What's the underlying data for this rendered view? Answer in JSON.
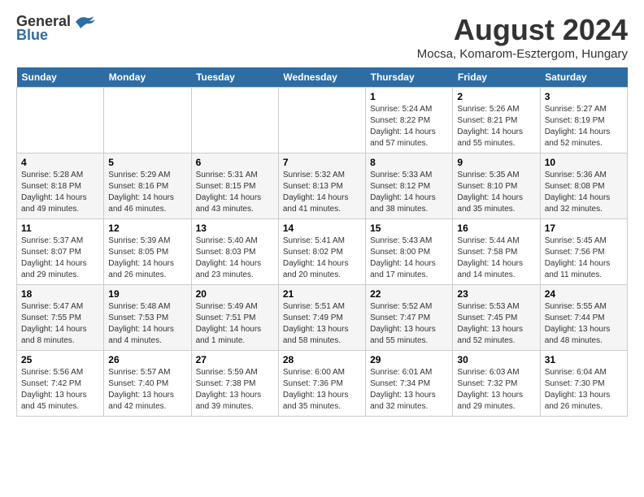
{
  "header": {
    "logo_general": "General",
    "logo_blue": "Blue",
    "month_year": "August 2024",
    "location": "Mocsa, Komarom-Esztergom, Hungary"
  },
  "days_of_week": [
    "Sunday",
    "Monday",
    "Tuesday",
    "Wednesday",
    "Thursday",
    "Friday",
    "Saturday"
  ],
  "weeks": [
    [
      {
        "day": "",
        "info": ""
      },
      {
        "day": "",
        "info": ""
      },
      {
        "day": "",
        "info": ""
      },
      {
        "day": "",
        "info": ""
      },
      {
        "day": "1",
        "info": "Sunrise: 5:24 AM\nSunset: 8:22 PM\nDaylight: 14 hours and 57 minutes."
      },
      {
        "day": "2",
        "info": "Sunrise: 5:26 AM\nSunset: 8:21 PM\nDaylight: 14 hours and 55 minutes."
      },
      {
        "day": "3",
        "info": "Sunrise: 5:27 AM\nSunset: 8:19 PM\nDaylight: 14 hours and 52 minutes."
      }
    ],
    [
      {
        "day": "4",
        "info": "Sunrise: 5:28 AM\nSunset: 8:18 PM\nDaylight: 14 hours and 49 minutes."
      },
      {
        "day": "5",
        "info": "Sunrise: 5:29 AM\nSunset: 8:16 PM\nDaylight: 14 hours and 46 minutes."
      },
      {
        "day": "6",
        "info": "Sunrise: 5:31 AM\nSunset: 8:15 PM\nDaylight: 14 hours and 43 minutes."
      },
      {
        "day": "7",
        "info": "Sunrise: 5:32 AM\nSunset: 8:13 PM\nDaylight: 14 hours and 41 minutes."
      },
      {
        "day": "8",
        "info": "Sunrise: 5:33 AM\nSunset: 8:12 PM\nDaylight: 14 hours and 38 minutes."
      },
      {
        "day": "9",
        "info": "Sunrise: 5:35 AM\nSunset: 8:10 PM\nDaylight: 14 hours and 35 minutes."
      },
      {
        "day": "10",
        "info": "Sunrise: 5:36 AM\nSunset: 8:08 PM\nDaylight: 14 hours and 32 minutes."
      }
    ],
    [
      {
        "day": "11",
        "info": "Sunrise: 5:37 AM\nSunset: 8:07 PM\nDaylight: 14 hours and 29 minutes."
      },
      {
        "day": "12",
        "info": "Sunrise: 5:39 AM\nSunset: 8:05 PM\nDaylight: 14 hours and 26 minutes."
      },
      {
        "day": "13",
        "info": "Sunrise: 5:40 AM\nSunset: 8:03 PM\nDaylight: 14 hours and 23 minutes."
      },
      {
        "day": "14",
        "info": "Sunrise: 5:41 AM\nSunset: 8:02 PM\nDaylight: 14 hours and 20 minutes."
      },
      {
        "day": "15",
        "info": "Sunrise: 5:43 AM\nSunset: 8:00 PM\nDaylight: 14 hours and 17 minutes."
      },
      {
        "day": "16",
        "info": "Sunrise: 5:44 AM\nSunset: 7:58 PM\nDaylight: 14 hours and 14 minutes."
      },
      {
        "day": "17",
        "info": "Sunrise: 5:45 AM\nSunset: 7:56 PM\nDaylight: 14 hours and 11 minutes."
      }
    ],
    [
      {
        "day": "18",
        "info": "Sunrise: 5:47 AM\nSunset: 7:55 PM\nDaylight: 14 hours and 8 minutes."
      },
      {
        "day": "19",
        "info": "Sunrise: 5:48 AM\nSunset: 7:53 PM\nDaylight: 14 hours and 4 minutes."
      },
      {
        "day": "20",
        "info": "Sunrise: 5:49 AM\nSunset: 7:51 PM\nDaylight: 14 hours and 1 minute."
      },
      {
        "day": "21",
        "info": "Sunrise: 5:51 AM\nSunset: 7:49 PM\nDaylight: 13 hours and 58 minutes."
      },
      {
        "day": "22",
        "info": "Sunrise: 5:52 AM\nSunset: 7:47 PM\nDaylight: 13 hours and 55 minutes."
      },
      {
        "day": "23",
        "info": "Sunrise: 5:53 AM\nSunset: 7:45 PM\nDaylight: 13 hours and 52 minutes."
      },
      {
        "day": "24",
        "info": "Sunrise: 5:55 AM\nSunset: 7:44 PM\nDaylight: 13 hours and 48 minutes."
      }
    ],
    [
      {
        "day": "25",
        "info": "Sunrise: 5:56 AM\nSunset: 7:42 PM\nDaylight: 13 hours and 45 minutes."
      },
      {
        "day": "26",
        "info": "Sunrise: 5:57 AM\nSunset: 7:40 PM\nDaylight: 13 hours and 42 minutes."
      },
      {
        "day": "27",
        "info": "Sunrise: 5:59 AM\nSunset: 7:38 PM\nDaylight: 13 hours and 39 minutes."
      },
      {
        "day": "28",
        "info": "Sunrise: 6:00 AM\nSunset: 7:36 PM\nDaylight: 13 hours and 35 minutes."
      },
      {
        "day": "29",
        "info": "Sunrise: 6:01 AM\nSunset: 7:34 PM\nDaylight: 13 hours and 32 minutes."
      },
      {
        "day": "30",
        "info": "Sunrise: 6:03 AM\nSunset: 7:32 PM\nDaylight: 13 hours and 29 minutes."
      },
      {
        "day": "31",
        "info": "Sunrise: 6:04 AM\nSunset: 7:30 PM\nDaylight: 13 hours and 26 minutes."
      }
    ]
  ]
}
